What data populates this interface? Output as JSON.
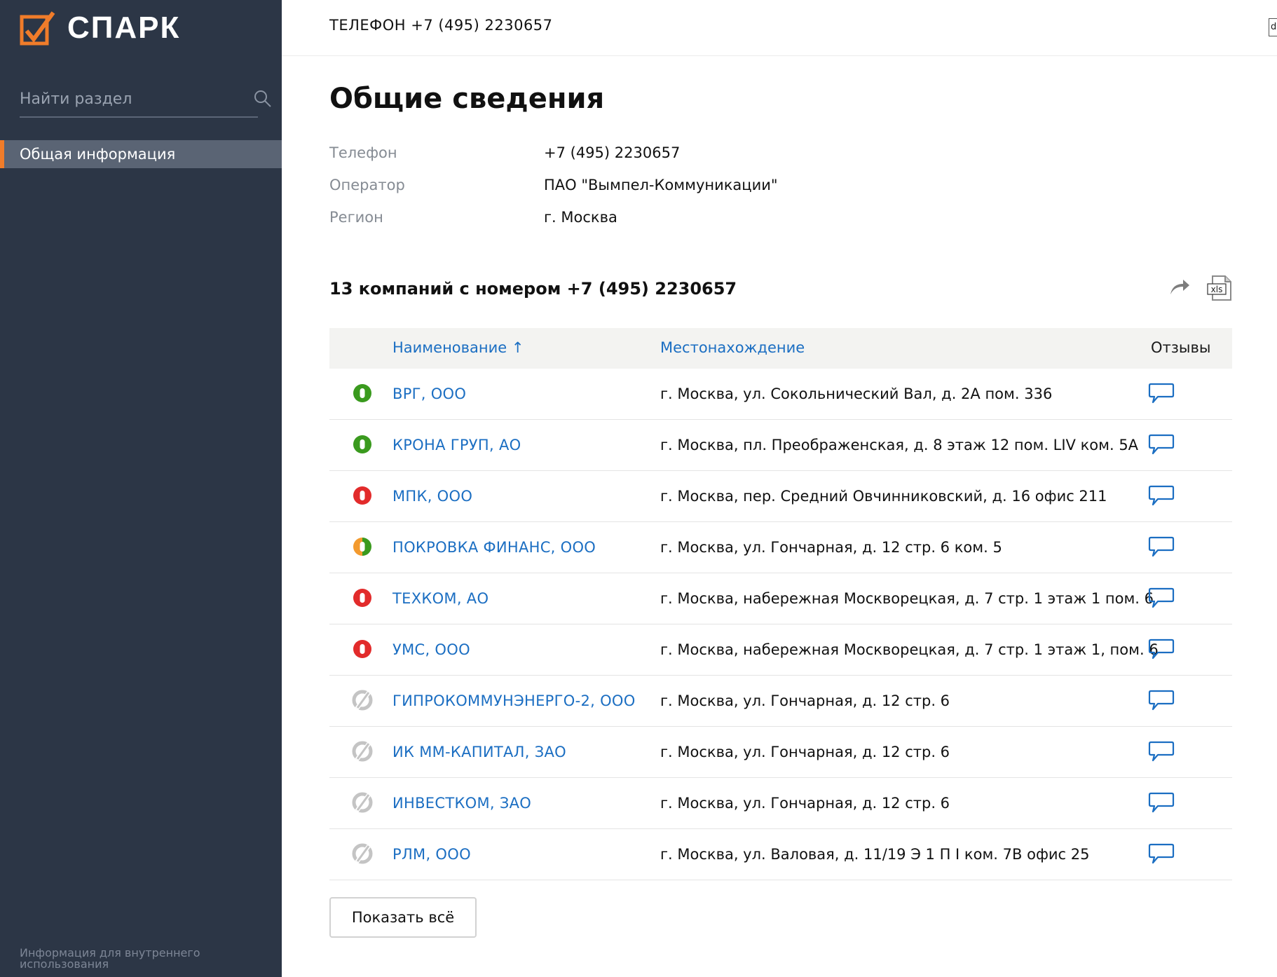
{
  "brand": {
    "name": "СПАРК",
    "accent": "#f07c2a",
    "sidebar_bg": "#2c3646",
    "link_color": "#1b6ec2"
  },
  "sidebar": {
    "search_placeholder": "Найти раздел",
    "items": [
      {
        "label": "Общая информация",
        "active": true
      }
    ],
    "footer": "Информация для внутреннего использования"
  },
  "header": {
    "title": "ТЕЛЕФОН +7 (495) 2230657",
    "mini": "d"
  },
  "main": {
    "title": "Общие сведения",
    "info": [
      {
        "label": "Телефон",
        "value": "+7 (495) 2230657"
      },
      {
        "label": "Оператор",
        "value": "ПАО \"Вымпел-Коммуникации\""
      },
      {
        "label": "Регион",
        "value": "г. Москва"
      }
    ],
    "companies_title": "13 компаний с номером +7 (495) 2230657",
    "table": {
      "columns": {
        "name": "Наименование ↑",
        "location": "Местонахождение",
        "reviews": "Отзывы"
      },
      "rows": [
        {
          "status": "green",
          "name": "ВРГ, ООО",
          "location": "г. Москва, ул. Сокольнический Вал, д. 2А пом. 336"
        },
        {
          "status": "green",
          "name": "КРОНА ГРУП, АО",
          "location": "г. Москва, пл. Преображенская, д. 8 этаж 12 пом. LIV ком. 5А"
        },
        {
          "status": "red",
          "name": "МПК, ООО",
          "location": "г. Москва, пер. Средний Овчинниковский, д. 16 офис 211"
        },
        {
          "status": "orange-green",
          "name": "ПОКРОВКА ФИНАНС, ООО",
          "location": "г. Москва, ул. Гончарная, д. 12 стр. 6 ком. 5"
        },
        {
          "status": "red",
          "name": "ТЕХКОМ, АО",
          "location": "г. Москва, набережная Москворецкая, д. 7 стр. 1 этаж 1 пом. 6"
        },
        {
          "status": "red",
          "name": "УМС, ООО",
          "location": "г. Москва, набережная Москворецкая, д. 7 стр. 1 этаж 1, пом. 6"
        },
        {
          "status": "inactive",
          "name": "ГИПРОКОММУНЭНЕРГО-2, ООО",
          "location": "г. Москва, ул. Гончарная, д. 12 стр. 6"
        },
        {
          "status": "inactive",
          "name": "ИК ММ-КАПИТАЛ, ЗАО",
          "location": "г. Москва, ул. Гончарная, д. 12 стр. 6"
        },
        {
          "status": "inactive",
          "name": "ИНВЕСТКОМ, ЗАО",
          "location": "г. Москва, ул. Гончарная, д. 12 стр. 6"
        },
        {
          "status": "inactive",
          "name": "РЛМ, ООО",
          "location": "г. Москва, ул. Валовая, д. 11/19 Э 1 П I ком. 7В офис 25"
        }
      ]
    },
    "show_all": "Показать всё",
    "xls_label": "xls"
  }
}
